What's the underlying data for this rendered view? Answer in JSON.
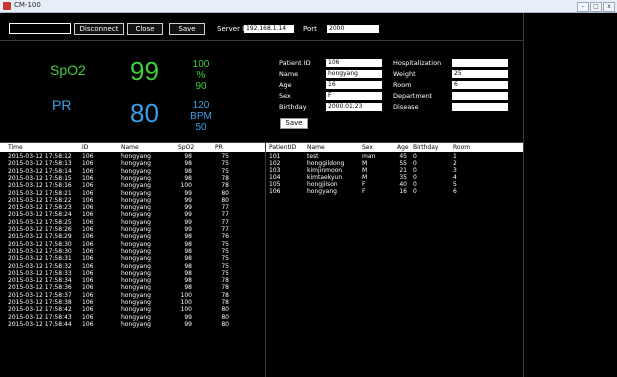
{
  "window": {
    "title": "CM-100",
    "min": "–",
    "max": "□",
    "close": "x"
  },
  "toolbar": {
    "disconnect_label": "Disconnect",
    "close_label": "Close",
    "save_label": "Save",
    "server_ip_label": "Server IP",
    "server_ip_value": "192.168.1.14",
    "port_label": "Port",
    "port_value": "2000"
  },
  "vitals": {
    "spo2_label": "SpO2",
    "spo2_value": "99",
    "spo2_high": "100",
    "spo2_unit": "%",
    "spo2_low": "90",
    "pr_label": "PR",
    "pr_value": "80",
    "pr_high": "120",
    "pr_unit": "BPM",
    "pr_low": "50"
  },
  "patient_form": {
    "patient_id_label": "Patient ID",
    "patient_id_value": "106",
    "name_label": "Name",
    "name_value": "hongyang",
    "age_label": "Age",
    "age_value": "16",
    "sex_label": "Sex",
    "sex_value": "F",
    "birthday_label": "Birthday",
    "birthday_value": "2000.01.23",
    "save_label": "Save",
    "hospitalization_label": "Hospitalization",
    "hospitalization_value": "",
    "weight_label": "Weight",
    "weight_value": "25",
    "room_label": "Room",
    "room_value": "6",
    "department_label": "Department",
    "department_value": "",
    "disease_label": "Disease",
    "disease_value": ""
  },
  "log_table": {
    "headers": [
      "Time",
      "ID",
      "Name",
      "SpO2",
      "PR"
    ],
    "rows": [
      [
        "2015-03-12 17:58:12",
        "106",
        "hongyang",
        "98",
        "75"
      ],
      [
        "2015-03-12 17:58:13",
        "106",
        "hongyang",
        "98",
        "75"
      ],
      [
        "2015-03-12 17:58:14",
        "106",
        "hongyang",
        "98",
        "75"
      ],
      [
        "2015-03-12 17:58:15",
        "106",
        "hongyang",
        "98",
        "78"
      ],
      [
        "2015-03-12 17:58:16",
        "106",
        "hongyang",
        "100",
        "78"
      ],
      [
        "2015-03-12 17:58:21",
        "106",
        "hongyang",
        "99",
        "80"
      ],
      [
        "2015-03-12 17:58:22",
        "106",
        "hongyang",
        "99",
        "80"
      ],
      [
        "2015-03-12 17:58:23",
        "106",
        "hongyang",
        "99",
        "77"
      ],
      [
        "2015-03-12 17:58:24",
        "106",
        "hongyang",
        "99",
        "77"
      ],
      [
        "2015-03-12 17:58:25",
        "106",
        "hongyang",
        "99",
        "77"
      ],
      [
        "2015-03-12 17:58:26",
        "106",
        "hongyang",
        "99",
        "77"
      ],
      [
        "2015-03-12 17:58:29",
        "106",
        "hongyang",
        "98",
        "76"
      ],
      [
        "2015-03-12 17:58:30",
        "106",
        "hongyang",
        "98",
        "75"
      ],
      [
        "2015-03-12 17:58:30",
        "106",
        "hongyang",
        "98",
        "75"
      ],
      [
        "2015-03-12 17:58:31",
        "106",
        "hongyang",
        "98",
        "75"
      ],
      [
        "2015-03-12 17:58:32",
        "106",
        "hongyang",
        "98",
        "75"
      ],
      [
        "2015-03-12 17:58:33",
        "106",
        "hongyang",
        "98",
        "75"
      ],
      [
        "2015-03-12 17:58:34",
        "106",
        "hongyang",
        "98",
        "78"
      ],
      [
        "2015-03-12 17:58:36",
        "106",
        "hongyang",
        "98",
        "78"
      ],
      [
        "2015-03-12 17:58:37",
        "106",
        "hongyang",
        "100",
        "78"
      ],
      [
        "2015-03-12 17:58:38",
        "106",
        "hongyang",
        "100",
        "78"
      ],
      [
        "2015-03-12 17:58:42",
        "106",
        "hongyang",
        "100",
        "80"
      ],
      [
        "2015-03-12 17:58:43",
        "106",
        "hongyang",
        "99",
        "80"
      ],
      [
        "2015-03-12 17:58:44",
        "106",
        "hongyang",
        "99",
        "80"
      ]
    ]
  },
  "patient_table": {
    "headers": [
      "PatientID",
      "Name",
      "Sex",
      "Age",
      "Birthday",
      "Room"
    ],
    "rows": [
      [
        "101",
        "test",
        "man",
        "45",
        "0",
        "1"
      ],
      [
        "102",
        "honggildong",
        "M",
        "55",
        "0",
        "2"
      ],
      [
        "103",
        "kimjinmoon",
        "M",
        "21",
        "0",
        "3"
      ],
      [
        "104",
        "kimtaekyun",
        "M",
        "35",
        "0",
        "4"
      ],
      [
        "105",
        "hongjilson",
        "F",
        "40",
        "0",
        "5"
      ],
      [
        "106",
        "hongyang",
        "F",
        "16",
        "0",
        "6"
      ]
    ]
  },
  "colors": {
    "spo2": "#3fcf3f",
    "pr": "#3aa0e8"
  }
}
